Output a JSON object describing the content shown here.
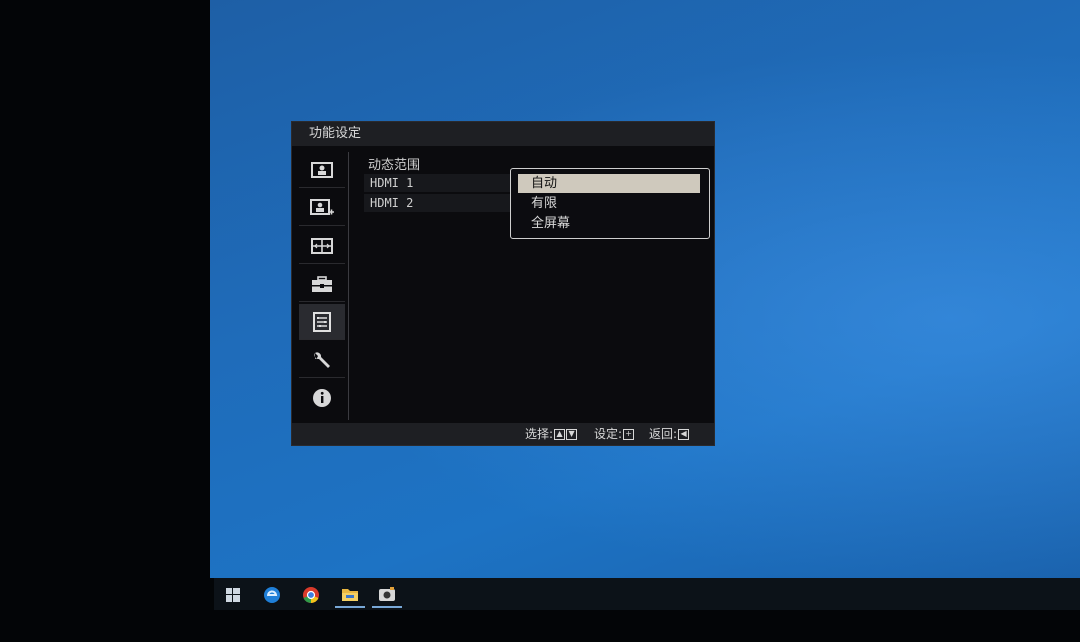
{
  "osd": {
    "title": "功能设定",
    "sidebar": [
      {
        "icon": "picture-icon",
        "selected": false
      },
      {
        "icon": "picture-plus-icon",
        "selected": false
      },
      {
        "icon": "layout-icon",
        "selected": false
      },
      {
        "icon": "toolbox-icon",
        "selected": false
      },
      {
        "icon": "function-list-icon",
        "selected": true
      },
      {
        "icon": "wrench-icon",
        "selected": false
      },
      {
        "icon": "info-icon",
        "selected": false
      }
    ],
    "content": {
      "heading": "动态范围",
      "rows": [
        "HDMI 1",
        "HDMI 2"
      ]
    },
    "dropdown": {
      "options": [
        "自动",
        "有限",
        "全屏幕"
      ],
      "selected": "自动"
    },
    "footer": {
      "select_label": "选择:",
      "confirm_label": "设定:",
      "back_label": "返回:"
    }
  },
  "taskbar": {
    "icons": [
      "windows-start-icon",
      "edge-icon",
      "chrome-icon",
      "file-explorer-icon",
      "camera-app-icon"
    ]
  }
}
